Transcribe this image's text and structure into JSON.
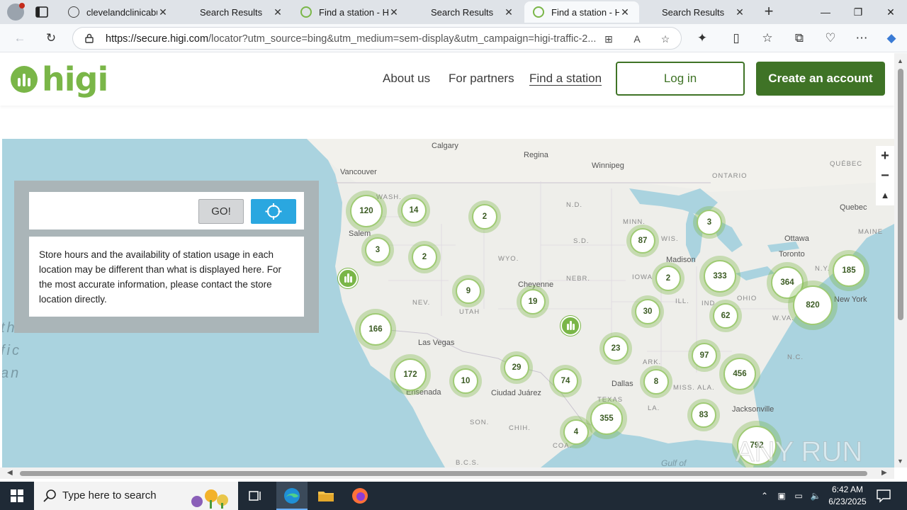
{
  "browser": {
    "tabs": [
      {
        "label": "clevelandclinicabuc",
        "favicon": "globe-icon",
        "active": false
      },
      {
        "label": "Search Results",
        "favicon": "none",
        "active": false
      },
      {
        "label": "Find a station - Hig",
        "favicon": "higi-icon",
        "active": false
      },
      {
        "label": "Search Results",
        "favicon": "none",
        "active": false
      },
      {
        "label": "Find a station - Hig",
        "favicon": "higi-icon",
        "active": true
      },
      {
        "label": "Search Results",
        "favicon": "none",
        "active": false
      }
    ],
    "url_domain": "https://secure.higi.com",
    "url_rest": "/locator?utm_source=bing&utm_medium=sem-display&utm_campaign=higi-traffic-2..."
  },
  "site": {
    "logo_text": "higi",
    "nav": {
      "about": "About us",
      "partners": "For partners",
      "find": "Find a station"
    },
    "login_label": "Log in",
    "create_label": "Create an account"
  },
  "search": {
    "placeholder": "",
    "go_label": "GO!",
    "notice": "Store hours and the availability of station usage in each location may be different than what is displayed here. For the most accurate information, please contact the store location directly."
  },
  "map": {
    "zoom_in": "+",
    "zoom_out": "−",
    "clusters": [
      "120",
      "14",
      "2",
      "3",
      "2",
      "87",
      "3",
      "2",
      "333",
      "364",
      "185",
      "820",
      "9",
      "19",
      "30",
      "62",
      "166",
      "23",
      "97",
      "172",
      "10",
      "29",
      "74",
      "8",
      "456",
      "355",
      "83",
      "4",
      "792"
    ],
    "labels": {
      "calgary": "Calgary",
      "regina": "Regina",
      "winnipeg": "Winnipeg",
      "ontario": "ONTARIO",
      "quebec_prov": "QUÉBEC",
      "vancouver": "Vancouver",
      "wash": "WASH.",
      "nd": "N.D.",
      "minn": "MINN.",
      "quebec": "Quebec",
      "maine": "MAINE",
      "ottawa": "Ottawa",
      "salem": "Salem",
      "sd": "S.D.",
      "wis": "WIS.",
      "toronto": "Toronto",
      "wyo": "WYO.",
      "madison": "Madison",
      "ny": "N.Y.",
      "nebr": "NEBR.",
      "iowa": "IOWA",
      "newyork": "New York",
      "cheyenne": "Cheyenne",
      "nev": "NEV.",
      "ill": "ILL.",
      "ind": "IND",
      "ohio": "OHIO",
      "utah": "UTAH",
      "wva": "W.VA.",
      "lasvegas": "Las Vegas",
      "nc": "N.C.",
      "ark": "ARK.",
      "ensenada": "Ensenada",
      "dallas": "Dallas",
      "ciudadjuarez": "Ciudad Juárez",
      "miss": "MISS.",
      "ala": "ALA.",
      "texas": "TEXAS",
      "la": "LA.",
      "jacksonville": "Jacksonville",
      "son": "SON.",
      "chih": "CHIH.",
      "coa": "COA.",
      "bcs": "B.C.S.",
      "gulf": "Gulf of",
      "ocean1": "th",
      "ocean2": "fic",
      "ocean3": "an"
    }
  },
  "watermark": "ANY RUN",
  "taskbar": {
    "search_placeholder": "Type here to search",
    "time": "6:42 AM",
    "date": "6/23/2025"
  },
  "colors": {
    "brand_green": "#7ab648",
    "dark_green": "#3f7326",
    "locate_blue": "#2aa7e0",
    "map_water": "#aad3df"
  }
}
